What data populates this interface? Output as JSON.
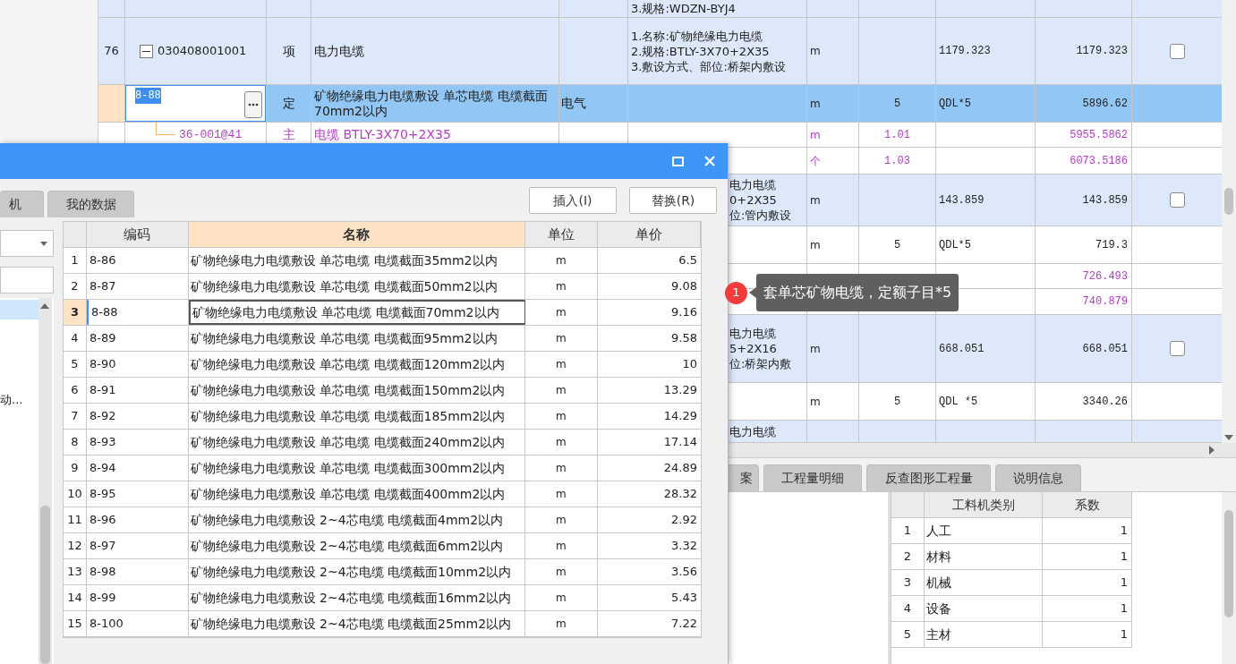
{
  "main_grid": {
    "rows": [
      {
        "kind": "bill",
        "selected": false,
        "editing": false,
        "features": [
          "3.规格:WDZN-BYJ4"
        ]
      },
      {
        "kind": "bill",
        "selected": false,
        "editing": false,
        "number": "76",
        "expanded": true,
        "code": "030408001001",
        "type": "项",
        "name": "电力电缆",
        "features": [
          "1.名称:矿物绝缘电力电缆",
          "2.规格:BTLY-3X70+2X35",
          "3.敷设方式、部位:桥架内敷设"
        ],
        "unit": "m",
        "formula": "1179.323",
        "amount": "1179.323",
        "checked": false
      },
      {
        "kind": "quota",
        "selected": true,
        "editing": true,
        "code": "8-88",
        "type": "定",
        "name": "矿物绝缘电力电缆敷设 单芯电缆 电缆截面70mm2以内",
        "specialty": "电气",
        "unit": "m",
        "quantity": "5",
        "formula": "QDL*5",
        "amount": "5896.62"
      },
      {
        "kind": "material",
        "selected": false,
        "editing": false,
        "code": "36-001@41",
        "type": "主",
        "name": "电缆 BTLY-3X70+2X35",
        "unit": "m",
        "quantity": "1.01",
        "amount": "5955.5862"
      },
      {
        "kind": "material",
        "selected": false,
        "editing": false,
        "unit": "个",
        "quantity": "1.03",
        "amount": "6073.5186"
      },
      {
        "kind": "bill",
        "selected": false,
        "editing": false,
        "features": [
          "电力电缆",
          "0+2X35",
          "位:管内敷设"
        ],
        "unit": "m",
        "formula": "143.859",
        "amount": "143.859",
        "checked": false
      },
      {
        "kind": "quota",
        "selected": false,
        "editing": false,
        "unit": "m",
        "quantity": "5",
        "formula": "QDL*5",
        "amount": "719.3"
      },
      {
        "kind": "material",
        "selected": false,
        "editing": false,
        "amount": "726.493"
      },
      {
        "kind": "material",
        "selected": false,
        "editing": false,
        "amount": "740.879"
      },
      {
        "kind": "bill",
        "selected": false,
        "editing": false,
        "features": [
          "电力电缆",
          "5+2X16",
          "位:桥架内敷"
        ],
        "unit": "m",
        "formula": "668.051",
        "amount": "668.051",
        "checked": false
      },
      {
        "kind": "quota",
        "selected": false,
        "editing": false,
        "unit": "m",
        "quantity": "5",
        "formula": "QDL *5",
        "amount": "3340.26"
      },
      {
        "kind": "bill",
        "selected": false,
        "editing": false,
        "features": [
          "电力电缆"
        ]
      }
    ]
  },
  "bottom_tabs": [
    {
      "label": "案",
      "selected": false
    },
    {
      "label": "工程量明细",
      "selected": false
    },
    {
      "label": "反查图形工程量",
      "selected": false
    },
    {
      "label": "说明信息",
      "selected": false
    }
  ],
  "category_table": {
    "columns": [
      "工料机类别",
      "系数"
    ],
    "rows": [
      {
        "number": "1",
        "category": "人工",
        "factor": "1"
      },
      {
        "number": "2",
        "category": "材料",
        "factor": "1"
      },
      {
        "number": "3",
        "category": "机械",
        "factor": "1"
      },
      {
        "number": "4",
        "category": "设备",
        "factor": "1"
      },
      {
        "number": "5",
        "category": "主材",
        "factor": "1"
      }
    ]
  },
  "dialog": {
    "tabs": [
      {
        "label": "机",
        "selected": false
      },
      {
        "label": "我的数据",
        "selected": false
      }
    ],
    "buttons": [
      "插入(I)",
      "替换(R)"
    ],
    "tree_items": [
      {
        "selected": true
      },
      {
        "label": "动...",
        "selected": false
      }
    ],
    "table": {
      "columns": [
        {
          "label": "编码",
          "selected": false
        },
        {
          "label": "名称",
          "selected": true
        },
        {
          "label": "单位",
          "selected": false
        },
        {
          "label": "单价",
          "selected": false
        }
      ],
      "rows": [
        {
          "number": "1",
          "code": "8-86",
          "name": "矿物绝缘电力电缆敷设 单芯电缆 电缆截面35mm2以内",
          "unit": "m",
          "price": "6.5",
          "selected": false
        },
        {
          "number": "2",
          "code": "8-87",
          "name": "矿物绝缘电力电缆敷设 单芯电缆 电缆截面50mm2以内",
          "unit": "m",
          "price": "9.08",
          "selected": false
        },
        {
          "number": "3",
          "code": "8-88",
          "name": "矿物绝缘电力电缆敷设 单芯电缆 电缆截面70mm2以内",
          "unit": "m",
          "price": "9.16",
          "selected": true
        },
        {
          "number": "4",
          "code": "8-89",
          "name": "矿物绝缘电力电缆敷设 单芯电缆 电缆截面95mm2以内",
          "unit": "m",
          "price": "9.58",
          "selected": false
        },
        {
          "number": "5",
          "code": "8-90",
          "name": "矿物绝缘电力电缆敷设 单芯电缆 电缆截面120mm2以内",
          "unit": "m",
          "price": "10",
          "selected": false
        },
        {
          "number": "6",
          "code": "8-91",
          "name": "矿物绝缘电力电缆敷设 单芯电缆 电缆截面150mm2以内",
          "unit": "m",
          "price": "13.29",
          "selected": false
        },
        {
          "number": "7",
          "code": "8-92",
          "name": "矿物绝缘电力电缆敷设 单芯电缆 电缆截面185mm2以内",
          "unit": "m",
          "price": "14.29",
          "selected": false
        },
        {
          "number": "8",
          "code": "8-93",
          "name": "矿物绝缘电力电缆敷设 单芯电缆 电缆截面240mm2以内",
          "unit": "m",
          "price": "17.14",
          "selected": false
        },
        {
          "number": "9",
          "code": "8-94",
          "name": "矿物绝缘电力电缆敷设 单芯电缆 电缆截面300mm2以内",
          "unit": "m",
          "price": "24.89",
          "selected": false
        },
        {
          "number": "10",
          "code": "8-95",
          "name": "矿物绝缘电力电缆敷设 单芯电缆 电缆截面400mm2以内",
          "unit": "m",
          "price": "28.32",
          "selected": false
        },
        {
          "number": "11",
          "code": "8-96",
          "name": "矿物绝缘电力电缆敷设 2~4芯电缆 电缆截面4mm2以内",
          "unit": "m",
          "price": "2.92",
          "selected": false
        },
        {
          "number": "12",
          "code": "8-97",
          "name": "矿物绝缘电力电缆敷设 2~4芯电缆 电缆截面6mm2以内",
          "unit": "m",
          "price": "3.32",
          "selected": false
        },
        {
          "number": "13",
          "code": "8-98",
          "name": "矿物绝缘电力电缆敷设 2~4芯电缆 电缆截面10mm2以内",
          "unit": "m",
          "price": "3.56",
          "selected": false
        },
        {
          "number": "14",
          "code": "8-99",
          "name": "矿物绝缘电力电缆敷设 2~4芯电缆 电缆截面16mm2以内",
          "unit": "m",
          "price": "5.43",
          "selected": false
        },
        {
          "number": "15",
          "code": "8-100",
          "name": "矿物绝缘电力电缆敷设 2~4芯电缆 电缆截面25mm2以内",
          "unit": "m",
          "price": "7.22",
          "selected": false
        }
      ]
    }
  },
  "callout": {
    "badge": "1",
    "text": "套单芯矿物电缆，定额子目*5"
  }
}
